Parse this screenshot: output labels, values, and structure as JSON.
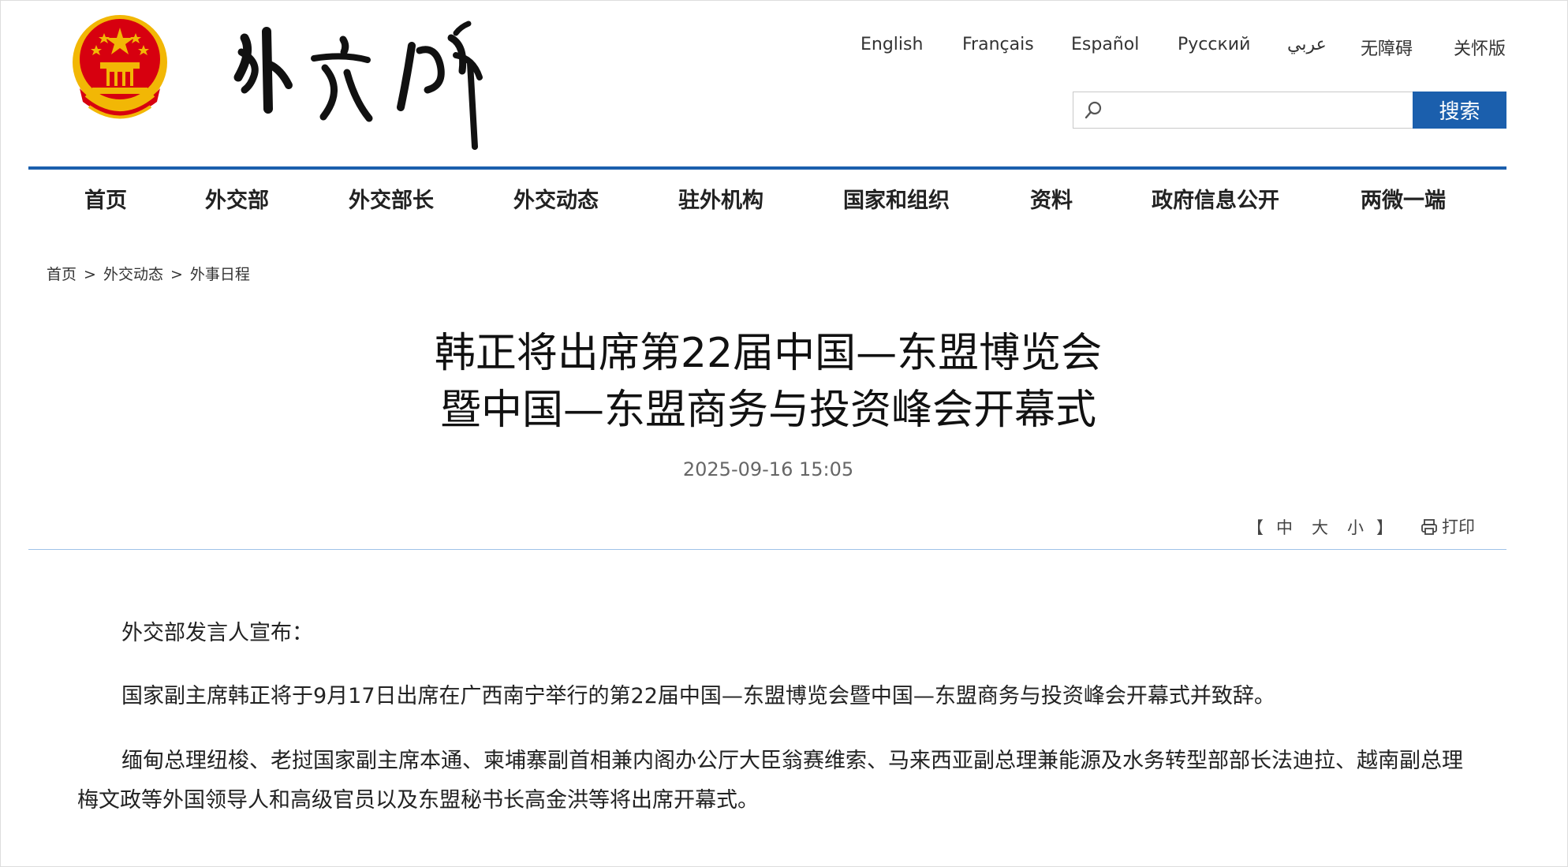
{
  "languages": [
    "English",
    "Français",
    "Español",
    "Русский",
    "عربي",
    "无障碍",
    "关怀版"
  ],
  "search": {
    "placeholder": "",
    "button_label": "搜索"
  },
  "nav": [
    "首页",
    "外交部",
    "外交部长",
    "外交动态",
    "驻外机构",
    "国家和组织",
    "资料",
    "政府信息公开",
    "两微一端"
  ],
  "breadcrumb": {
    "items": [
      "首页",
      "外交动态",
      "外事日程"
    ],
    "separator": ">"
  },
  "article": {
    "title_lines": [
      "韩正将出席第22届中国—东盟博览会",
      "暨中国—东盟商务与投资峰会开幕式"
    ],
    "date": "2025-09-16 15:05",
    "paragraphs": [
      "外交部发言人宣布：",
      "国家副主席韩正将于9月17日出席在广西南宁举行的第22届中国—东盟博览会暨中国—东盟商务与投资峰会开幕式并致辞。",
      "缅甸总理纽梭、老挝国家副主席本通、柬埔寨副首相兼内阁办公厅大臣翁赛维索、马来西亚副总理兼能源及水务转型部部长法迪拉、越南副总理梅文政等外国领导人和高级官员以及东盟秘书长高金洪等将出席开幕式。"
    ]
  },
  "tools": {
    "open_bracket": "【",
    "close_bracket": "】",
    "sizes": [
      "中",
      "大",
      "小"
    ],
    "print_label": "打印"
  },
  "colors": {
    "accent": "#1b5fad",
    "divider": "#9fc3e8",
    "emblem_red": "#d7000f",
    "emblem_gold": "#f2b705"
  }
}
